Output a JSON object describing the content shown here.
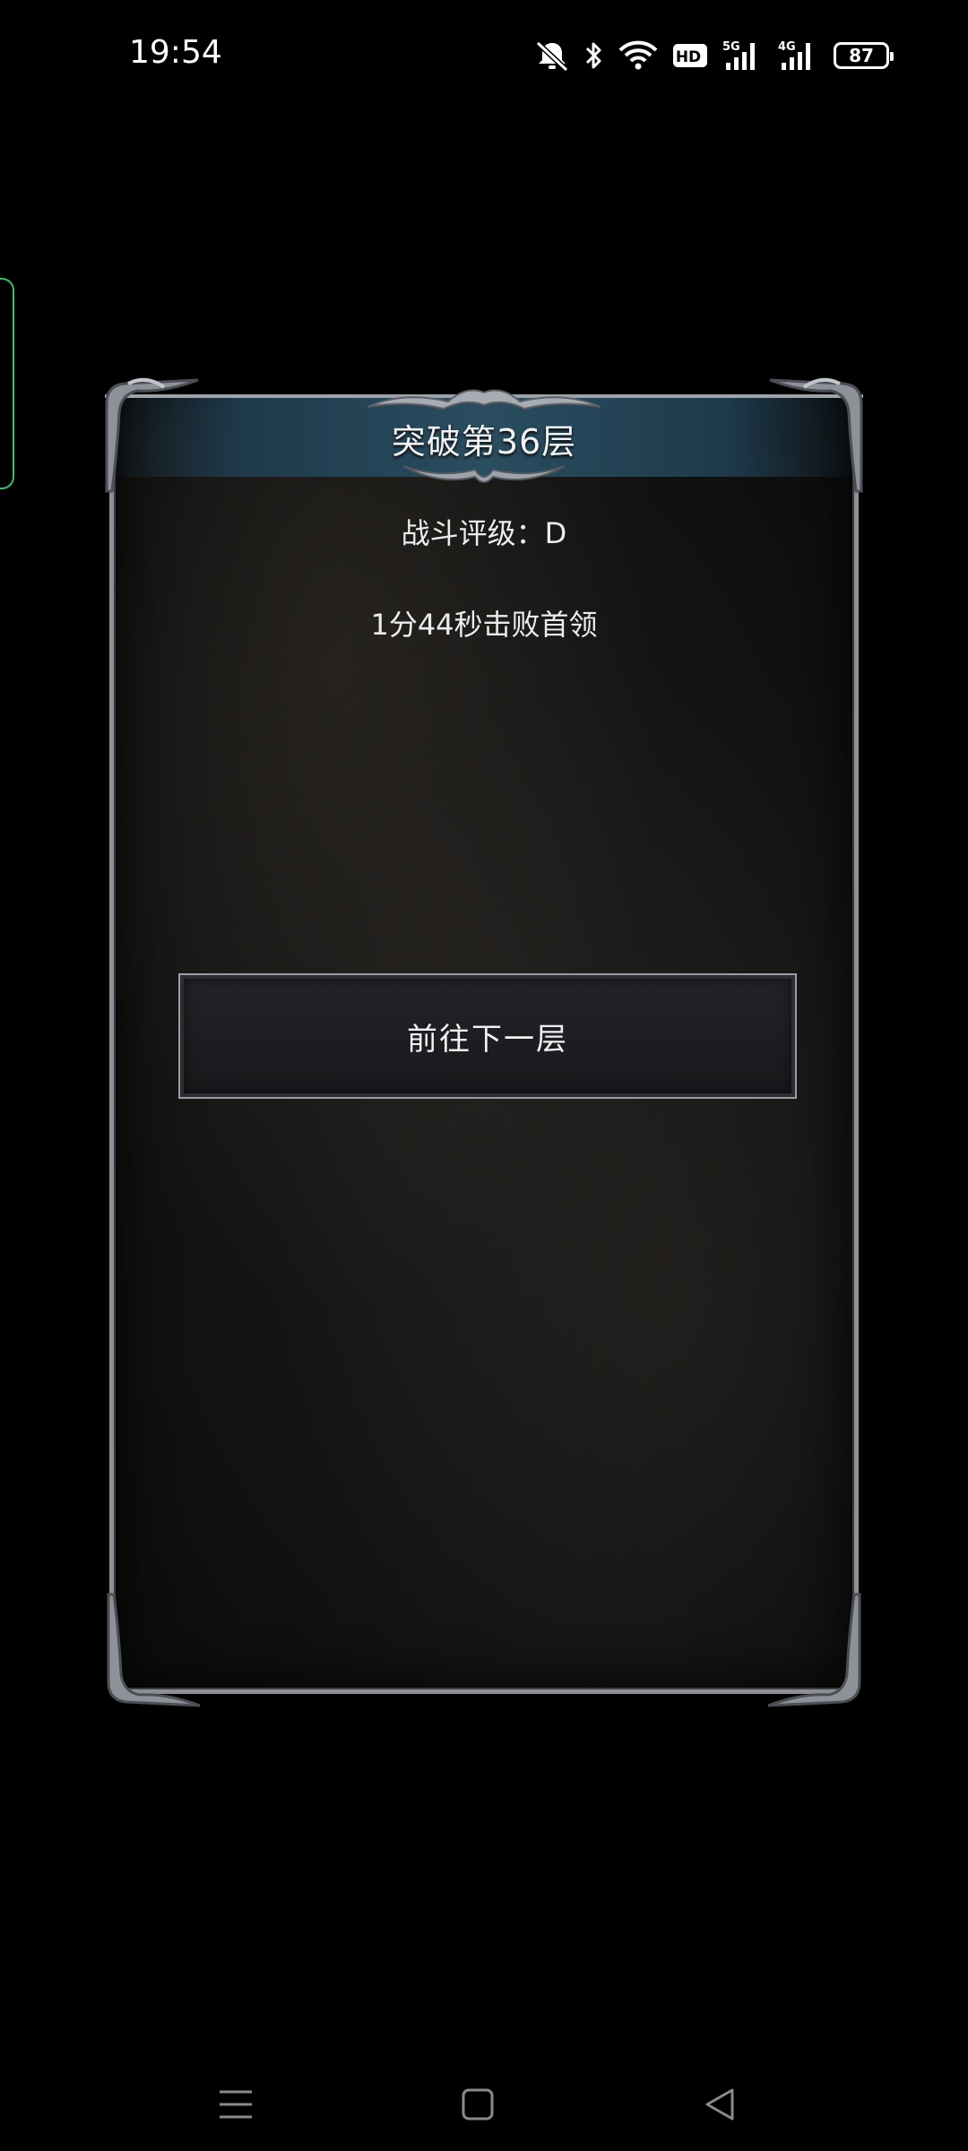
{
  "status_bar": {
    "time": "19:54",
    "icons": [
      "mute-icon",
      "bluetooth-icon",
      "wifi-icon",
      "hd-icon",
      "5g-signal-icon",
      "4g-signal-icon"
    ],
    "network_5g": "5G",
    "network_4g": "4G",
    "hd_label": "HD",
    "battery_level": "87"
  },
  "dialog": {
    "title": "突破第36层",
    "rating": "战斗评级：D",
    "result": "1分44秒击败首领",
    "next_button_label": "前往下一层"
  },
  "nav_bar": {
    "icons": [
      "menu-icon",
      "home-icon",
      "back-icon"
    ]
  },
  "colors": {
    "background": "#000000",
    "panel_border": "#8c8f96",
    "header_band": "#2a4d60",
    "side_tab_border": "#33c26b",
    "text": "#ededed"
  }
}
